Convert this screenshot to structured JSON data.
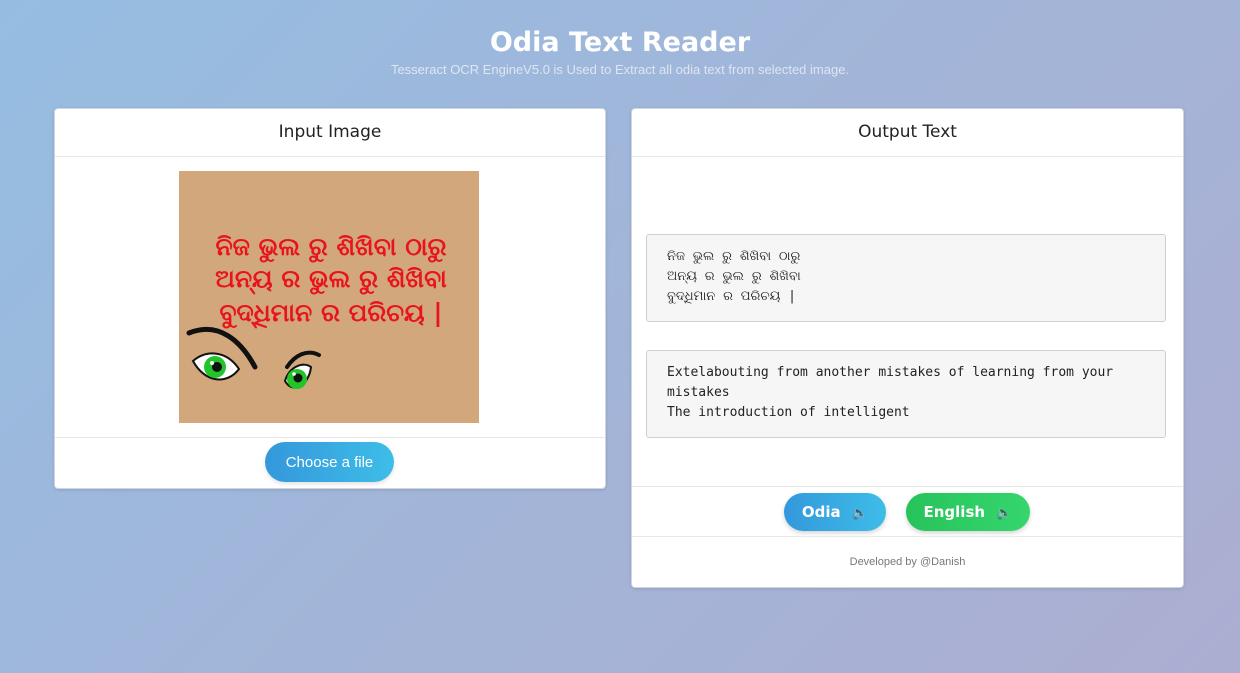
{
  "header": {
    "title": "Odia Text Reader",
    "subtitle": "Tesseract OCR EngineV5.0 is Used to Extract all odia text from selected image."
  },
  "input_card": {
    "title": "Input Image",
    "image_lines": [
      "ନିଜ ଭୁଲ ରୁ ଶିଖିବା ଠାରୁ",
      "ଅନ୍ୟ ର ଭୁଲ ରୁ ଶିଖିବା",
      "ବୁଦ୍ଧିମାନ ର ପରିଚୟ |"
    ],
    "choose_file_label": "Choose a file"
  },
  "output_card": {
    "title": "Output Text",
    "odia_text": "ନିଜ ଭୁଲ ରୁ ଶିଖିବା ଠାରୁ\nଅନ୍ୟ ର ଭୁଲ ରୁ ଶିଖିବା\nବୁଦ୍ଧିମାନ ର ପରିଚୟ |",
    "english_text": "Extelabouting from another mistakes of learning from your mistakes\nThe introduction of intelligent",
    "odia_button_label": "Odia",
    "english_button_label": "English",
    "speaker_icon": "speaker-icon",
    "footer": "Developed by @Danish"
  },
  "colors": {
    "blue_button": "#3498db",
    "green_button": "#2ecc71",
    "image_background": "#d2a77c",
    "image_text": "#e8141c",
    "eye_iris": "#22c42a"
  }
}
